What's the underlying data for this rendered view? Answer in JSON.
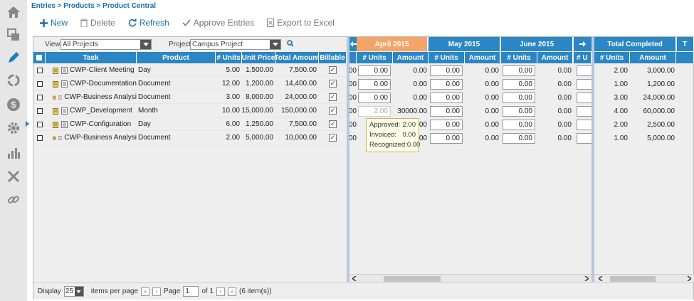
{
  "breadcrumb": "Entries > Products > Product Central",
  "toolbar": {
    "new_label": "New",
    "delete_label": "Delete",
    "refresh_label": "Refresh",
    "approve_label": "Approve Entries",
    "export_label": "Export to Excel"
  },
  "filters": {
    "view_label": "View:",
    "view_value": "All Projects",
    "project_label": "Project:",
    "project_value": "Campus Project"
  },
  "columns": {
    "task": "Task",
    "product": "Product",
    "units": "# Units",
    "unit_price": "Unit Price",
    "total_amount": "Total Amount",
    "billable": "Billable"
  },
  "months": {
    "april": "April 2015",
    "may": "May 2015",
    "june": "June 2015",
    "units": "# Units",
    "amount": "Amount",
    "units_cut": "# U",
    "total_completed": "Total Completed",
    "total_cut": "T"
  },
  "rows": [
    {
      "task": "CWP-Client Meeting",
      "product": "Day",
      "units": "5.00",
      "unit_price": "1,500.00",
      "total": "7,500.00",
      "apr_units": "0.00",
      "apr_amount": "0.00",
      "may_units": "0.00",
      "may_amount": "0.00",
      "jun_units": "0.00",
      "jun_amount": "0.00",
      "tc_units": "2.00",
      "tc_amount": "3,000.00"
    },
    {
      "task": "CWP-Documentation",
      "product": "Document",
      "units": "12.00",
      "unit_price": "1,200.00",
      "total": "14,400.00",
      "apr_units": "0.00",
      "apr_amount": "0.00",
      "may_units": "0.00",
      "may_amount": "0.00",
      "jun_units": "0.00",
      "jun_amount": "0.00",
      "tc_units": "1.00",
      "tc_amount": "1,200.00"
    },
    {
      "task": "CWP-Business Analysi",
      "product": "Document",
      "units": "3.00",
      "unit_price": "8,000.00",
      "total": "24,000.00",
      "apr_units": "0.00",
      "apr_amount": "0.00",
      "may_units": "0.00",
      "may_amount": "0.00",
      "jun_units": "0.00",
      "jun_amount": "0.00",
      "tc_units": "3.00",
      "tc_amount": "24,000.00"
    },
    {
      "task": "CWP_Development",
      "product": "Month",
      "units": "10.00",
      "unit_price": "15,000.00",
      "total": "150,000.00",
      "apr_units": "2.00",
      "apr_amount": "30000.00",
      "may_units": "0.00",
      "may_amount": "0.00",
      "jun_units": "0.00",
      "jun_amount": "0.00",
      "tc_units": "4.00",
      "tc_amount": "60,000.00"
    },
    {
      "task": "CWP-Configuration",
      "product": "Day",
      "units": "6.00",
      "unit_price": "1,250.00",
      "total": "7,500.00",
      "apr_units": "",
      "apr_amount": "00",
      "may_units": "0.00",
      "may_amount": "0.00",
      "jun_units": "0.00",
      "jun_amount": "0.00",
      "tc_units": "2.00",
      "tc_amount": "2,500.00"
    },
    {
      "task": "CWP-Business Analysi",
      "product": "Document",
      "units": "2.00",
      "unit_price": "5,000.00",
      "total": "10,000.00",
      "apr_units": "",
      "apr_amount": "00",
      "may_units": "0.00",
      "may_amount": "0.00",
      "jun_units": "0.00",
      "jun_amount": "0.00",
      "tc_units": "1.00",
      "tc_amount": "5,000.00"
    }
  ],
  "row_prefix": "00",
  "tooltip": {
    "approved_label": "Approved:",
    "approved_value": "2.00",
    "invoiced_label": "Invoiced:",
    "invoiced_value": "0.00",
    "recognized_label": "Recognized:",
    "recognized_value": "0.00"
  },
  "footer": {
    "display_label": "Display",
    "page_size": "25",
    "items_per_page": "items per page",
    "page_label": "Page",
    "page_value": "1",
    "of_label": "of 1",
    "item_count": "(6 item(s))"
  },
  "colors": {
    "accent": "#2a86c4",
    "highlight": "#f5a467",
    "link": "#1a6fb0"
  }
}
